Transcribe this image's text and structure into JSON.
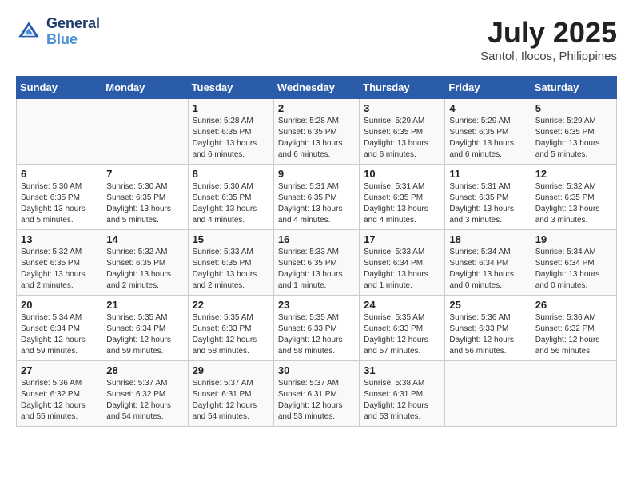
{
  "header": {
    "logo_line1": "General",
    "logo_line2": "Blue",
    "month_year": "July 2025",
    "location": "Santol, Ilocos, Philippines"
  },
  "days_of_week": [
    "Sunday",
    "Monday",
    "Tuesday",
    "Wednesday",
    "Thursday",
    "Friday",
    "Saturday"
  ],
  "weeks": [
    [
      {
        "day": "",
        "info": ""
      },
      {
        "day": "",
        "info": ""
      },
      {
        "day": "1",
        "info": "Sunrise: 5:28 AM\nSunset: 6:35 PM\nDaylight: 13 hours\nand 6 minutes."
      },
      {
        "day": "2",
        "info": "Sunrise: 5:28 AM\nSunset: 6:35 PM\nDaylight: 13 hours\nand 6 minutes."
      },
      {
        "day": "3",
        "info": "Sunrise: 5:29 AM\nSunset: 6:35 PM\nDaylight: 13 hours\nand 6 minutes."
      },
      {
        "day": "4",
        "info": "Sunrise: 5:29 AM\nSunset: 6:35 PM\nDaylight: 13 hours\nand 6 minutes."
      },
      {
        "day": "5",
        "info": "Sunrise: 5:29 AM\nSunset: 6:35 PM\nDaylight: 13 hours\nand 5 minutes."
      }
    ],
    [
      {
        "day": "6",
        "info": "Sunrise: 5:30 AM\nSunset: 6:35 PM\nDaylight: 13 hours\nand 5 minutes."
      },
      {
        "day": "7",
        "info": "Sunrise: 5:30 AM\nSunset: 6:35 PM\nDaylight: 13 hours\nand 5 minutes."
      },
      {
        "day": "8",
        "info": "Sunrise: 5:30 AM\nSunset: 6:35 PM\nDaylight: 13 hours\nand 4 minutes."
      },
      {
        "day": "9",
        "info": "Sunrise: 5:31 AM\nSunset: 6:35 PM\nDaylight: 13 hours\nand 4 minutes."
      },
      {
        "day": "10",
        "info": "Sunrise: 5:31 AM\nSunset: 6:35 PM\nDaylight: 13 hours\nand 4 minutes."
      },
      {
        "day": "11",
        "info": "Sunrise: 5:31 AM\nSunset: 6:35 PM\nDaylight: 13 hours\nand 3 minutes."
      },
      {
        "day": "12",
        "info": "Sunrise: 5:32 AM\nSunset: 6:35 PM\nDaylight: 13 hours\nand 3 minutes."
      }
    ],
    [
      {
        "day": "13",
        "info": "Sunrise: 5:32 AM\nSunset: 6:35 PM\nDaylight: 13 hours\nand 2 minutes."
      },
      {
        "day": "14",
        "info": "Sunrise: 5:32 AM\nSunset: 6:35 PM\nDaylight: 13 hours\nand 2 minutes."
      },
      {
        "day": "15",
        "info": "Sunrise: 5:33 AM\nSunset: 6:35 PM\nDaylight: 13 hours\nand 2 minutes."
      },
      {
        "day": "16",
        "info": "Sunrise: 5:33 AM\nSunset: 6:35 PM\nDaylight: 13 hours\nand 1 minute."
      },
      {
        "day": "17",
        "info": "Sunrise: 5:33 AM\nSunset: 6:34 PM\nDaylight: 13 hours\nand 1 minute."
      },
      {
        "day": "18",
        "info": "Sunrise: 5:34 AM\nSunset: 6:34 PM\nDaylight: 13 hours\nand 0 minutes."
      },
      {
        "day": "19",
        "info": "Sunrise: 5:34 AM\nSunset: 6:34 PM\nDaylight: 13 hours\nand 0 minutes."
      }
    ],
    [
      {
        "day": "20",
        "info": "Sunrise: 5:34 AM\nSunset: 6:34 PM\nDaylight: 12 hours\nand 59 minutes."
      },
      {
        "day": "21",
        "info": "Sunrise: 5:35 AM\nSunset: 6:34 PM\nDaylight: 12 hours\nand 59 minutes."
      },
      {
        "day": "22",
        "info": "Sunrise: 5:35 AM\nSunset: 6:33 PM\nDaylight: 12 hours\nand 58 minutes."
      },
      {
        "day": "23",
        "info": "Sunrise: 5:35 AM\nSunset: 6:33 PM\nDaylight: 12 hours\nand 58 minutes."
      },
      {
        "day": "24",
        "info": "Sunrise: 5:35 AM\nSunset: 6:33 PM\nDaylight: 12 hours\nand 57 minutes."
      },
      {
        "day": "25",
        "info": "Sunrise: 5:36 AM\nSunset: 6:33 PM\nDaylight: 12 hours\nand 56 minutes."
      },
      {
        "day": "26",
        "info": "Sunrise: 5:36 AM\nSunset: 6:32 PM\nDaylight: 12 hours\nand 56 minutes."
      }
    ],
    [
      {
        "day": "27",
        "info": "Sunrise: 5:36 AM\nSunset: 6:32 PM\nDaylight: 12 hours\nand 55 minutes."
      },
      {
        "day": "28",
        "info": "Sunrise: 5:37 AM\nSunset: 6:32 PM\nDaylight: 12 hours\nand 54 minutes."
      },
      {
        "day": "29",
        "info": "Sunrise: 5:37 AM\nSunset: 6:31 PM\nDaylight: 12 hours\nand 54 minutes."
      },
      {
        "day": "30",
        "info": "Sunrise: 5:37 AM\nSunset: 6:31 PM\nDaylight: 12 hours\nand 53 minutes."
      },
      {
        "day": "31",
        "info": "Sunrise: 5:38 AM\nSunset: 6:31 PM\nDaylight: 12 hours\nand 53 minutes."
      },
      {
        "day": "",
        "info": ""
      },
      {
        "day": "",
        "info": ""
      }
    ]
  ]
}
